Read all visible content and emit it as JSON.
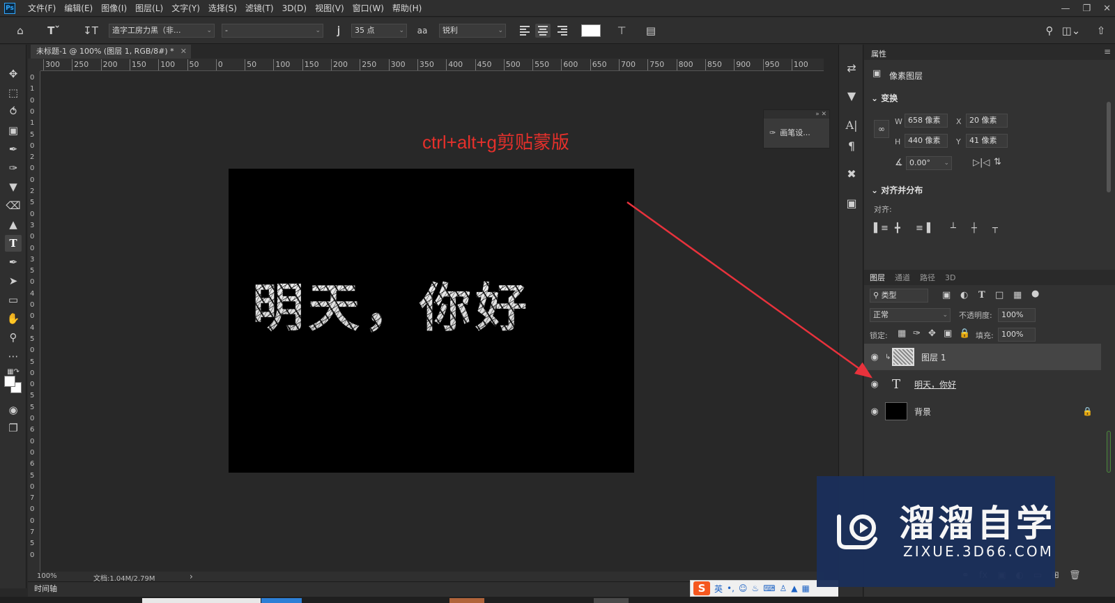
{
  "menubar": {
    "logo": "Ps",
    "items": [
      "文件(F)",
      "编辑(E)",
      "图像(I)",
      "图层(L)",
      "文字(Y)",
      "选择(S)",
      "滤镜(T)",
      "3D(D)",
      "视图(V)",
      "窗口(W)",
      "帮助(H)"
    ]
  },
  "options": {
    "font_family": "造字工房力黑（非...",
    "font_style": "-",
    "font_size": "35 点",
    "antialias_label": "aa",
    "antialias": "锐利"
  },
  "document": {
    "tab_title": "未标题-1 @ 100% (图层 1, RGB/8#) *",
    "canvas_text": "明天，你好",
    "annotation": "ctrl+alt+g剪贴蒙版"
  },
  "ruler": {
    "top_labels": [
      "300",
      "250",
      "200",
      "150",
      "100",
      "50",
      "0",
      "50",
      "100",
      "150",
      "200",
      "250",
      "300",
      "350",
      "400",
      "450",
      "500",
      "550",
      "600",
      "650",
      "700",
      "750",
      "800",
      "850",
      "900",
      "950",
      "100"
    ],
    "left_digits": [
      "0",
      "1",
      "0",
      "0",
      "1",
      "5",
      "0",
      "2",
      "0",
      "0",
      "2",
      "5",
      "0",
      "3",
      "0",
      "0",
      "3",
      "5",
      "0",
      "4",
      "0",
      "0",
      "4",
      "5",
      "0",
      "5",
      "0",
      "0",
      "5",
      "5",
      "0",
      "6",
      "0",
      "0",
      "6",
      "5",
      "0",
      "7",
      "0",
      "0",
      "7",
      "5",
      "0"
    ]
  },
  "brush_panel": {
    "label": "画笔设..."
  },
  "status": {
    "zoom": "100%",
    "doc_info": "文档:1.04M/2.79M",
    "timeline": "时间轴"
  },
  "properties": {
    "title": "属性",
    "pixel_layer": "像素图层",
    "transform": "变换",
    "w_label": "W",
    "w_value": "658 像素",
    "x_label": "X",
    "x_value": "20 像素",
    "h_label": "H",
    "h_value": "440 像素",
    "y_label": "Y",
    "y_value": "41 像素",
    "angle_value": "0.00°",
    "align_section": "对齐并分布",
    "align_label": "对齐:"
  },
  "layers_panel": {
    "tabs": [
      "图层",
      "通道",
      "路径",
      "3D"
    ],
    "filter_kind": "类型",
    "blend_mode": "正常",
    "opacity_label": "不透明度:",
    "opacity_value": "100%",
    "lock_label": "锁定:",
    "fill_label": "填充:",
    "fill_value": "100%",
    "layers": [
      {
        "name": "图层 1",
        "type": "pixel",
        "selected": true,
        "clipped": true
      },
      {
        "name": "明天，你好",
        "type": "text",
        "selected": false
      },
      {
        "name": "背景",
        "type": "background",
        "selected": false,
        "locked": true
      }
    ]
  },
  "ime": {
    "mode": "英"
  },
  "watermark": {
    "title": "溜溜自学",
    "url": "ZIXUE.3D66.COM"
  },
  "colors": {
    "accent": "#31a8ff",
    "annotation_red": "#e5302b",
    "arrow_red": "#e8323c",
    "watermark_blue": "#1b2f5a"
  }
}
